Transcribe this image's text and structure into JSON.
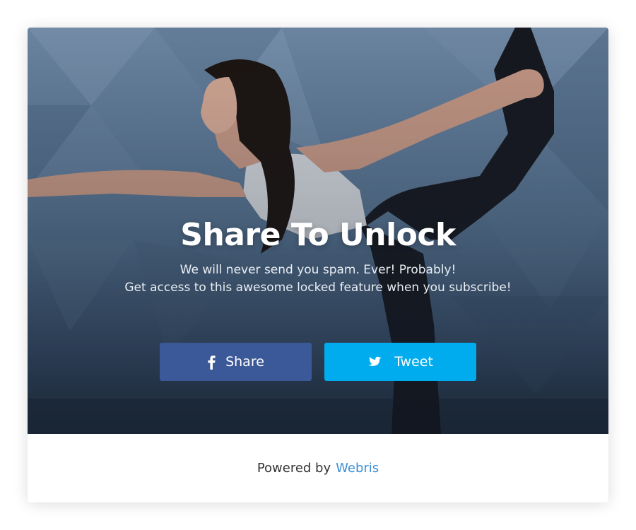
{
  "modal": {
    "title": "Share To Unlock",
    "subtitle_line1": "We will never send you spam. Ever! Probably!",
    "subtitle_line2": "Get access to this awesome locked feature when you subscribe!",
    "hero_image": "woman-yoga-dancer-pose-photo"
  },
  "buttons": {
    "share": {
      "label": "Share",
      "icon": "facebook-icon",
      "color": "#3b5998"
    },
    "tweet": {
      "label": "Tweet",
      "icon": "twitter-icon",
      "color": "#00acee"
    }
  },
  "footer": {
    "powered_by": "Powered by",
    "brand": "Webris",
    "brand_color": "#3b8fd6"
  }
}
